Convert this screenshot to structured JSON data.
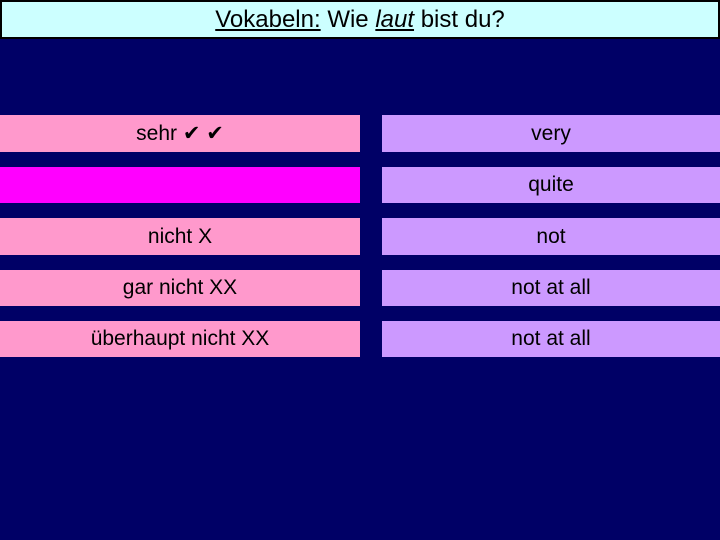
{
  "title": {
    "part1": "Vokabeln:",
    "part2": " Wie ",
    "part3": "laut",
    "part4": " bist du?"
  },
  "colors": {
    "background": "#000066",
    "title_bg": "#CCFFFF",
    "german_box": "#FF99CC",
    "german_box_highlight": "#FF00FF",
    "english_box": "#CC99FF"
  },
  "rows": [
    {
      "german": "sehr ✔ ✔",
      "english": "very"
    },
    {
      "german": "",
      "english": "quite"
    },
    {
      "german": "nicht X",
      "english": "not"
    },
    {
      "german": "gar nicht XX",
      "english": "not at all"
    },
    {
      "german": "überhaupt nicht XX",
      "english": "not at all"
    }
  ]
}
